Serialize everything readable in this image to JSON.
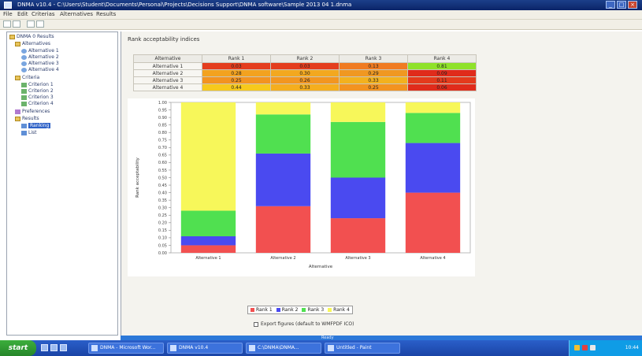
{
  "window": {
    "title": "DNMA v10.4 - C:\\Users\\Student\\Documents\\Personal\\Projects\\Decisions Support\\DNMA software\\Sample 2013 04 1.dnma",
    "buttons": [
      "_",
      "□",
      "×"
    ]
  },
  "menu": [
    "File",
    "Edit",
    "Criterias",
    "Alternatives",
    "Results"
  ],
  "tree": {
    "root": "DNMA 0 Results",
    "alternatives": "Alternatives",
    "alternative_items": [
      "Alternative 1",
      "Alternative 2",
      "Alternative 3",
      "Alternative 4"
    ],
    "criteria": "Criteria",
    "criteria_items": [
      "Criterion 1",
      "Criterion 2",
      "Criterion 3",
      "Criterion 4"
    ],
    "preferences": "Preferences",
    "results": "Results",
    "result_items": [
      "Ranking",
      "List"
    ]
  },
  "panel": {
    "title": "Rank acceptability indices"
  },
  "table": {
    "corner": "Alternative",
    "ranks": [
      "Rank 1",
      "Rank 2",
      "Rank 3",
      "Rank 4"
    ],
    "rows": [
      {
        "name": "Alternative 1",
        "cells": [
          "0.03",
          "0.03",
          "0.13",
          "0.81"
        ],
        "colors": [
          "#e43d1e",
          "#e43d1e",
          "#f07b22",
          "#8fe22a"
        ]
      },
      {
        "name": "Alternative 2",
        "cells": [
          "0.28",
          "0.30",
          "0.29",
          "0.09"
        ],
        "colors": [
          "#f3a21f",
          "#f3a81f",
          "#f09821",
          "#e02b1b"
        ]
      },
      {
        "name": "Alternative 3",
        "cells": [
          "0.25",
          "0.26",
          "0.33",
          "0.11"
        ],
        "colors": [
          "#f39320",
          "#f39620",
          "#f3b11e",
          "#e43a1c"
        ]
      },
      {
        "name": "Alternative 4",
        "cells": [
          "0.44",
          "0.33",
          "0.25",
          "0.06"
        ],
        "colors": [
          "#f7c91c",
          "#f5ae1e",
          "#f39320",
          "#e02b1b"
        ]
      }
    ]
  },
  "chart_data": {
    "type": "bar",
    "stacked": true,
    "categories": [
      "Alternative 1",
      "Alternative 2",
      "Alternative 3",
      "Alternative 4"
    ],
    "series": [
      {
        "name": "Rank 1",
        "color": "#f25050",
        "values": [
          0.05,
          0.31,
          0.23,
          0.4
        ]
      },
      {
        "name": "Rank 2",
        "color": "#4a4af0",
        "values": [
          0.06,
          0.35,
          0.27,
          0.33
        ]
      },
      {
        "name": "Rank 3",
        "color": "#50e050",
        "values": [
          0.17,
          0.26,
          0.37,
          0.2
        ]
      },
      {
        "name": "Rank 4",
        "color": "#f7f75a",
        "values": [
          0.72,
          0.08,
          0.13,
          0.07
        ]
      }
    ],
    "ylim": [
      0,
      1
    ],
    "yticks": [
      "0.00",
      "0.05",
      "0.10",
      "0.15",
      "0.20",
      "0.25",
      "0.30",
      "0.35",
      "0.40",
      "0.45",
      "0.50",
      "0.55",
      "0.60",
      "0.65",
      "0.70",
      "0.75",
      "0.80",
      "0.85",
      "0.90",
      "0.95",
      "1.00"
    ],
    "xlabel": "Alternative",
    "ylabel": "Rank acceptability",
    "grid": false,
    "legend": "bottom"
  },
  "checkbox_label": "Export figures (default to WMFPDF ICO)",
  "status": "Ready",
  "taskbar": {
    "start": "start",
    "tasks": [
      "DNMA - Microsoft Wor...",
      "DNMA v10.4",
      "C:\\DNMA\\DNMA...",
      "Untitled - Paint"
    ],
    "clock": "10:44"
  }
}
